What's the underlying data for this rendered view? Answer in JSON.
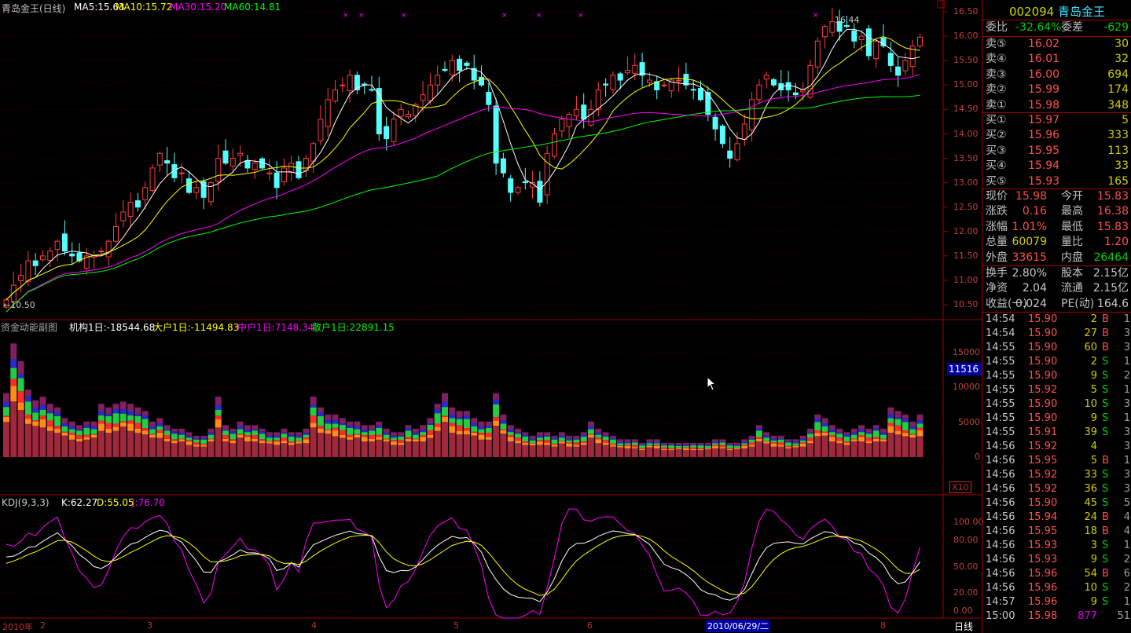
{
  "header": {
    "title": "青岛金王(日线)",
    "ma5": "MA5:15.63",
    "ma10": "MA10:15.72",
    "ma30": "MA30:15.20",
    "ma60": "MA60:14.81",
    "high_mark": "16.44",
    "low_mark": "10.50"
  },
  "volume_panel": {
    "title": "资金动能副图",
    "jg": "机构1日:-18544.68",
    "dh": "大户1日:-11494.83",
    "zh": "中户1日:7148.34",
    "sh": "散户1日:22891.15",
    "cursor_value": "11516",
    "scale": "X10"
  },
  "kdj_panel": {
    "title": "KDJ(9,3,3)",
    "k": "K:62.27",
    "d": "D:55.05",
    "j": "J:76.70"
  },
  "axes": {
    "price": [
      "16.50",
      "16.00",
      "15.50",
      "15.00",
      "14.50",
      "14.00",
      "13.50",
      "13.00",
      "12.50",
      "12.00",
      "11.50",
      "11.00",
      "10.50"
    ],
    "volume": [
      "15000",
      "10000",
      "5000",
      "0"
    ],
    "kdj": [
      "100.00",
      "80.00",
      "50.00",
      "20.00",
      "0.00"
    ],
    "dates": [
      "2010年",
      "2",
      "3",
      "4",
      "5",
      "6",
      "8"
    ],
    "selected_date": "2010/06/29/二",
    "period": "日线"
  },
  "quote": {
    "code": "002094",
    "name": "青岛金王",
    "wb_label": "委比",
    "wb": "-32.64%",
    "wc_label": "委差",
    "wc": "-629",
    "sells": [
      {
        "l": "卖⑤",
        "p": "16.02",
        "v": "30"
      },
      {
        "l": "卖④",
        "p": "16.01",
        "v": "32"
      },
      {
        "l": "卖③",
        "p": "16.00",
        "v": "694"
      },
      {
        "l": "卖②",
        "p": "15.99",
        "v": "174"
      },
      {
        "l": "卖①",
        "p": "15.98",
        "v": "348"
      }
    ],
    "buys": [
      {
        "l": "买①",
        "p": "15.97",
        "v": "5"
      },
      {
        "l": "买②",
        "p": "15.96",
        "v": "333"
      },
      {
        "l": "买③",
        "p": "15.95",
        "v": "113"
      },
      {
        "l": "买④",
        "p": "15.94",
        "v": "33"
      },
      {
        "l": "买⑤",
        "p": "15.93",
        "v": "165"
      }
    ],
    "stats": [
      {
        "a": "现价",
        "av": "15.98",
        "b": "今开",
        "bv": "15.83",
        "ac": "red",
        "bc": "red"
      },
      {
        "a": "涨跌",
        "av": "0.16",
        "b": "最高",
        "bv": "16.38",
        "ac": "red",
        "bc": "red"
      },
      {
        "a": "涨幅",
        "av": "1.01%",
        "b": "最低",
        "bv": "15.83",
        "ac": "red",
        "bc": "red"
      },
      {
        "a": "总量",
        "av": "60079",
        "b": "量比",
        "bv": "1.20",
        "ac": "yel",
        "bc": "red"
      },
      {
        "a": "外盘",
        "av": "33615",
        "b": "内盘",
        "bv": "26464",
        "ac": "red",
        "bc": "grn"
      }
    ],
    "fin": [
      {
        "a": "换手",
        "av": "2.80%",
        "b": "股本",
        "bv": "2.15亿"
      },
      {
        "a": "净资",
        "av": "2.04",
        "b": "流通",
        "bv": "2.15亿"
      },
      {
        "a": "收益(一)",
        "av": "0.024",
        "b": "PE(动)",
        "bv": "164.6"
      }
    ]
  },
  "trades": [
    [
      "14:54",
      "15.90",
      "2",
      "B",
      "1"
    ],
    [
      "14:54",
      "15.90",
      "27",
      "B",
      "3"
    ],
    [
      "14:55",
      "15.90",
      "60",
      "B",
      "3"
    ],
    [
      "14:55",
      "15.90",
      "2",
      "S",
      "1"
    ],
    [
      "14:55",
      "15.90",
      "9",
      "S",
      "2"
    ],
    [
      "14:55",
      "15.92",
      "5",
      "S",
      "1"
    ],
    [
      "14:55",
      "15.90",
      "10",
      "S",
      "3"
    ],
    [
      "14:55",
      "15.90",
      "9",
      "S",
      "1"
    ],
    [
      "14:55",
      "15.91",
      "39",
      "S",
      "3"
    ],
    [
      "14:56",
      "15.92",
      "4",
      "",
      "3"
    ],
    [
      "14:56",
      "15.95",
      "5",
      "B",
      "1"
    ],
    [
      "14:56",
      "15.92",
      "33",
      "S",
      "3"
    ],
    [
      "14:56",
      "15.92",
      "36",
      "S",
      "3"
    ],
    [
      "14:56",
      "15.90",
      "45",
      "S",
      "5"
    ],
    [
      "14:56",
      "15.94",
      "24",
      "B",
      "4"
    ],
    [
      "14:56",
      "15.95",
      "18",
      "B",
      "4"
    ],
    [
      "14:56",
      "15.93",
      "3",
      "S",
      "1"
    ],
    [
      "14:56",
      "15.93",
      "9",
      "S",
      "2"
    ],
    [
      "14:56",
      "15.96",
      "54",
      "B",
      "6"
    ],
    [
      "14:56",
      "15.96",
      "10",
      "S",
      "2"
    ],
    [
      "14:57",
      "15.96",
      "9",
      "S",
      "1"
    ],
    [
      "15:00",
      "15.98",
      "877",
      "",
      "51"
    ]
  ],
  "chart_data": {
    "type": "candlestick",
    "ylim": [
      10.5,
      16.5
    ],
    "closes": [
      10.6,
      10.9,
      11.1,
      11.4,
      11.3,
      11.5,
      11.6,
      11.8,
      11.6,
      11.5,
      11.4,
      11.5,
      11.5,
      11.6,
      11.8,
      12.1,
      12.4,
      12.6,
      12.5,
      12.9,
      13.3,
      13.6,
      13.4,
      13.1,
      13.2,
      12.8,
      12.9,
      12.7,
      13.0,
      13.5,
      13.4,
      13.5,
      13.6,
      13.3,
      13.4,
      13.3,
      13.2,
      12.9,
      13.3,
      13.4,
      13.1,
      13.5,
      13.8,
      14.3,
      14.7,
      14.9,
      15.0,
      15.2,
      14.9,
      15.0,
      14.9,
      14.0,
      13.9,
      14.3,
      14.5,
      14.4,
      14.6,
      14.8,
      15.0,
      15.2,
      15.3,
      15.5,
      15.3,
      15.4,
      15.1,
      15.0,
      14.6,
      13.4,
      13.2,
      12.8,
      12.9,
      13.0,
      13.0,
      12.6,
      13.6,
      14.0,
      14.3,
      14.4,
      14.5,
      14.3,
      14.5,
      14.9,
      15.0,
      15.2,
      15.1,
      15.3,
      15.4,
      15.2,
      15.1,
      14.9,
      15.0,
      15.1,
      15.1,
      15.0,
      14.9,
      14.7,
      14.4,
      14.1,
      13.8,
      13.5,
      13.8,
      14.2,
      14.7,
      15.0,
      15.2,
      15.0,
      14.9,
      14.9,
      14.8,
      14.9,
      15.4,
      15.9,
      16.2,
      16.3,
      16.1,
      16.2,
      15.9,
      16.0,
      15.6,
      15.9,
      15.8,
      15.4,
      15.2,
      15.5,
      15.8,
      15.98
    ],
    "volume": [
      9000,
      16000,
      13500,
      9500,
      8000,
      8500,
      7500,
      7000,
      5500,
      5000,
      4500,
      5000,
      5000,
      7500,
      7000,
      7500,
      7800,
      7500,
      7000,
      6500,
      5000,
      5500,
      4500,
      4000,
      4000,
      3500,
      3000,
      3000,
      4000,
      8500,
      4500,
      4000,
      5000,
      4500,
      4500,
      4000,
      3500,
      3500,
      4000,
      3500,
      3500,
      4000,
      8500,
      7000,
      6000,
      6000,
      5500,
      5000,
      5000,
      4500,
      4500,
      5000,
      4000,
      3500,
      3500,
      4500,
      4000,
      4500,
      5500,
      7500,
      9000,
      7000,
      6500,
      6500,
      5500,
      5000,
      5000,
      9000,
      6000,
      4500,
      4000,
      3500,
      3000,
      3500,
      3500,
      3000,
      3500,
      3000,
      3000,
      3500,
      5000,
      4000,
      3500,
      3000,
      2500,
      2500,
      2500,
      2000,
      2500,
      2500,
      2000,
      2000,
      2000,
      2000,
      2000,
      2000,
      2000,
      2500,
      2500,
      2000,
      2000,
      2500,
      3000,
      4500,
      3500,
      3000,
      3000,
      2500,
      2500,
      3000,
      4000,
      6000,
      5500,
      4500,
      4000,
      3500,
      4000,
      4500,
      4000,
      4500,
      4000,
      7000,
      6500,
      6000,
      5000,
      6000
    ]
  }
}
